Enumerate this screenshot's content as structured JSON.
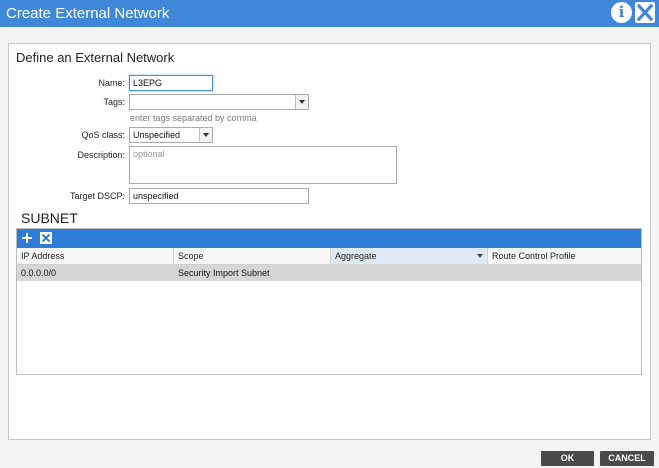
{
  "dialog": {
    "title": "Create External Network",
    "info_icon": "info-icon",
    "close_icon": "close-icon"
  },
  "form": {
    "section_title": "Define an External Network",
    "name": {
      "label": "Name:",
      "value": "L3EPG"
    },
    "tags": {
      "label": "Tags:",
      "value": "",
      "hint": "enter tags separated by comma"
    },
    "qos": {
      "label": "QoS class:",
      "value": "Unspecified"
    },
    "description": {
      "label": "Description:",
      "placeholder": "optional"
    },
    "target_dscp": {
      "label": "Target DSCP:",
      "value": "unspecified"
    }
  },
  "subnet": {
    "title": "SUBNET",
    "toolbar": {
      "add_icon": "plus-icon",
      "delete_icon": "delete-icon"
    },
    "columns": [
      "IP Address",
      "Scope",
      "Aggregate",
      "Route Control Profile"
    ],
    "rows": [
      {
        "ip": "0.0.0.0/0",
        "scope": "Security Import Subnet",
        "aggregate": "",
        "route_control_profile": ""
      }
    ]
  },
  "footer": {
    "ok_label": "OK",
    "cancel_label": "CANCEL"
  },
  "colors": {
    "title_bar": "#3f87d9",
    "grid_toolbar": "#2d7dd6",
    "selected_row": "#d6d6d6",
    "button_bg": "#4a4a4a"
  }
}
